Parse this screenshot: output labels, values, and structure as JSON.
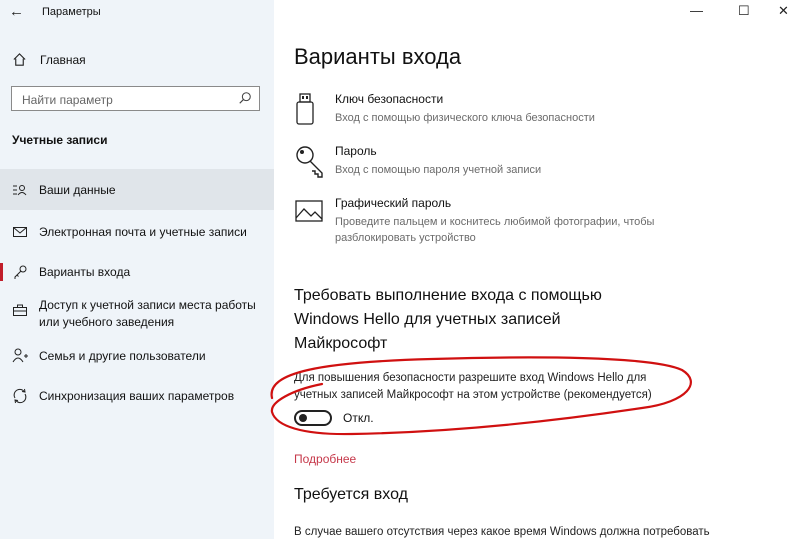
{
  "window": {
    "title": "Параметры",
    "back_glyph": "←",
    "minimize_glyph": "—",
    "maximize_glyph": "☐",
    "close_glyph": "✕"
  },
  "sidebar": {
    "home_label": "Главная",
    "search_placeholder": "Найти параметр",
    "section_heading": "Учетные записи",
    "items": [
      {
        "label": "Ваши данные",
        "icon": "person-card-icon",
        "selected": true
      },
      {
        "label": "Электронная почта и учетные записи",
        "icon": "mail-icon"
      },
      {
        "label": "Варианты входа",
        "icon": "key-icon",
        "active": true
      },
      {
        "label": "Доступ к учетной записи места работы или учебного заведения",
        "icon": "briefcase-icon"
      },
      {
        "label": "Семья и другие пользователи",
        "icon": "person-add-icon"
      },
      {
        "label": "Синхронизация ваших параметров",
        "icon": "sync-icon"
      }
    ]
  },
  "main": {
    "title": "Варианты входа",
    "options": [
      {
        "title": "Ключ безопасности",
        "desc": "Вход с помощью физического ключа безопасности",
        "icon": "usb-key-icon"
      },
      {
        "title": "Пароль",
        "desc": "Вход с помощью пароля учетной записи",
        "icon": "key-icon"
      },
      {
        "title": "Графический пароль",
        "desc": "Проведите пальцем и коснитесь любимой фотографии, чтобы разблокировать устройство",
        "icon": "picture-icon"
      }
    ],
    "hello_heading": "Требовать выполнение входа с помощью Windows Hello для учетных записей Майкрософт",
    "hello_desc": "Для повышения безопасности разрешите вход Windows Hello для учетных записей Майкрософт на этом устройстве (рекомендуется)",
    "toggle_state": "Откл.",
    "learn_more": "Подробнее",
    "require_heading": "Требуется вход",
    "require_desc": "В случае вашего отсутствия через какое время Windows должна потребовать"
  },
  "colors": {
    "accent": "#c11d2a",
    "link": "#c6384a",
    "annotation": "#d01010",
    "sidebar_bg": "#eff4f9"
  }
}
